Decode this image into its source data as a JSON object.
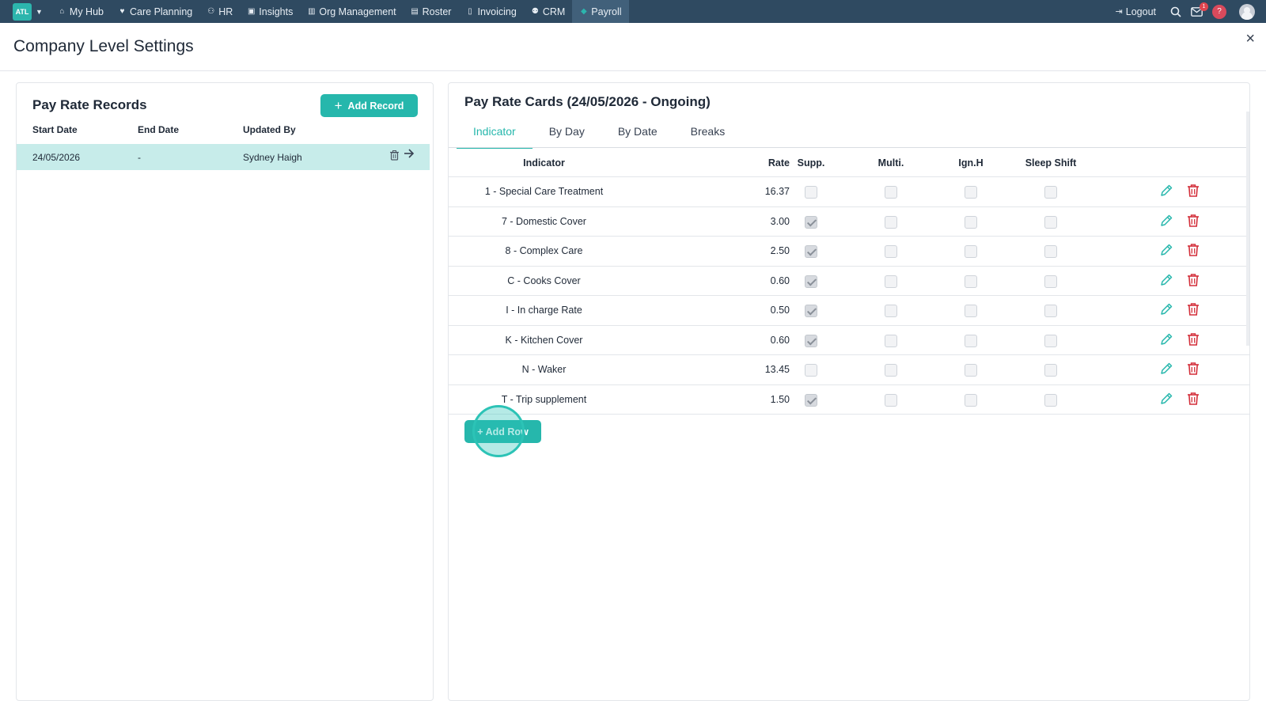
{
  "topnav": {
    "logo_text": "ATL",
    "items": [
      {
        "label": "My Hub",
        "icon": "home-icon"
      },
      {
        "label": "Care Planning",
        "icon": "heart-icon"
      },
      {
        "label": "HR",
        "icon": "people-icon"
      },
      {
        "label": "Insights",
        "icon": "chart-icon"
      },
      {
        "label": "Org Management",
        "icon": "building-icon"
      },
      {
        "label": "Roster",
        "icon": "calendar-icon"
      },
      {
        "label": "Invoicing",
        "icon": "document-icon"
      },
      {
        "label": "CRM",
        "icon": "contacts-icon"
      },
      {
        "label": "Payroll",
        "icon": "diamond-icon",
        "active": true
      }
    ],
    "logout_label": "Logout",
    "mail_badge": "1",
    "help_label": "?"
  },
  "page": {
    "title": "Company Level Settings",
    "close_label": "×"
  },
  "records": {
    "title": "Pay Rate Records",
    "add_button": "Add Record",
    "columns": [
      "Start Date",
      "End Date",
      "Updated By"
    ],
    "rows": [
      {
        "start": "24/05/2026",
        "end": "-",
        "updated_by": "Sydney Haigh"
      }
    ]
  },
  "cards": {
    "title": "Pay Rate Cards (24/05/2026 - Ongoing)",
    "tabs": [
      "Indicator",
      "By Day",
      "By Date",
      "Breaks"
    ],
    "active_tab": "Indicator",
    "columns": {
      "indicator": "Indicator",
      "rate": "Rate",
      "supp": "Supp.",
      "multi": "Multi.",
      "ign": "Ign.H",
      "sleep": "Sleep Shift"
    },
    "rows": [
      {
        "indicator": "1 - Special Care Treatment",
        "rate": "16.37",
        "supp": false,
        "multi": false,
        "ign": false,
        "sleep": false
      },
      {
        "indicator": "7 - Domestic Cover",
        "rate": "3.00",
        "supp": true,
        "multi": false,
        "ign": false,
        "sleep": false
      },
      {
        "indicator": "8 - Complex Care",
        "rate": "2.50",
        "supp": true,
        "multi": false,
        "ign": false,
        "sleep": false
      },
      {
        "indicator": "C - Cooks Cover",
        "rate": "0.60",
        "supp": true,
        "multi": false,
        "ign": false,
        "sleep": false
      },
      {
        "indicator": "I - In charge Rate",
        "rate": "0.50",
        "supp": true,
        "multi": false,
        "ign": false,
        "sleep": false
      },
      {
        "indicator": "K - Kitchen Cover",
        "rate": "0.60",
        "supp": true,
        "multi": false,
        "ign": false,
        "sleep": false
      },
      {
        "indicator": "N - Waker",
        "rate": "13.45",
        "supp": false,
        "multi": false,
        "ign": false,
        "sleep": false
      },
      {
        "indicator": "T - Trip supplement",
        "rate": "1.50",
        "supp": true,
        "multi": false,
        "ign": false,
        "sleep": false
      }
    ],
    "add_row_label": "+ Add Row"
  },
  "colors": {
    "nav_bg": "#2f4a61",
    "accent": "#26b7ac",
    "selected_row": "#c7ecea",
    "delete_red": "#d32f3a"
  }
}
